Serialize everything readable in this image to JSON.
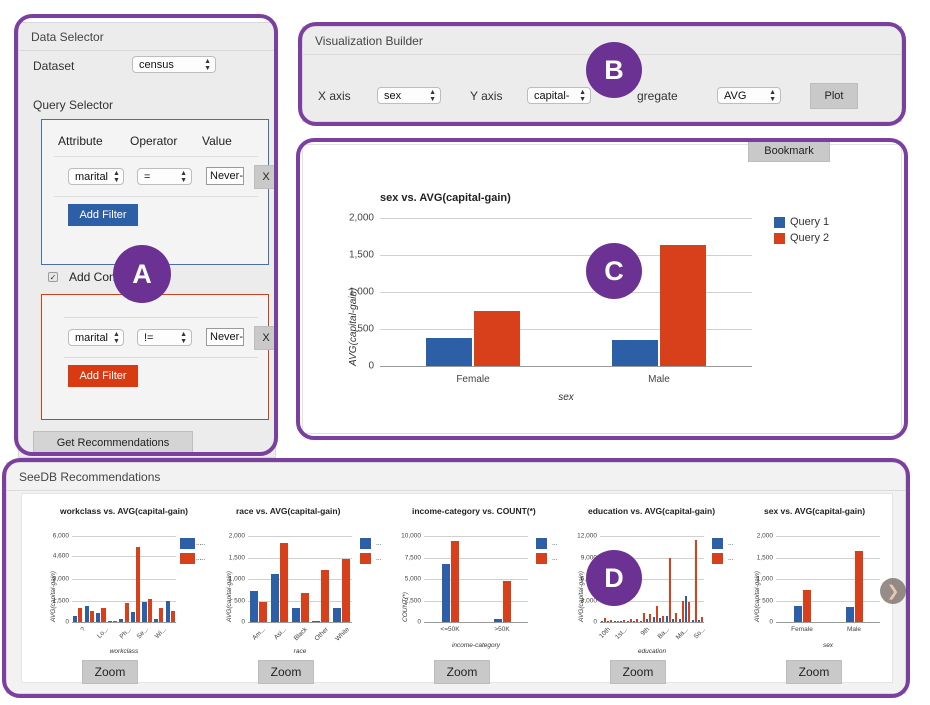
{
  "colors": {
    "annotation_purple": "#7B3FA0",
    "badge_purple": "#6B3294",
    "query1_blue": "#2D5FA6",
    "query2_red": "#D8401B",
    "panel_grey": "#ececec"
  },
  "data_selector": {
    "title": "Data Selector",
    "dataset_label": "Dataset",
    "dataset_value": "census",
    "query_selector_label": "Query Selector",
    "columns": {
      "attribute": "Attribute",
      "operator": "Operator",
      "value": "Value"
    },
    "query1": {
      "attribute": "marital",
      "operator": "=",
      "value": "Never-",
      "remove_label": "X",
      "add_filter_label": "Add Filter"
    },
    "add_comparison_label": "Add Compa",
    "add_comparison_checked": true,
    "query2": {
      "attribute": "marital",
      "operator": "!=",
      "value": "Never-",
      "remove_label": "X",
      "add_filter_label": "Add Filter"
    },
    "get_recommendations_label": "Get Recommendations"
  },
  "visualization_builder": {
    "title": "Visualization Builder",
    "x_axis_label": "X axis",
    "x_axis_value": "sex",
    "y_axis_label": "Y axis",
    "y_axis_value": "capital-",
    "aggregate_label": "gregate",
    "aggregate_value": "AVG",
    "plot_label": "Plot"
  },
  "main_view": {
    "bookmark_label": "Bookmark"
  },
  "recommendations": {
    "title": "SeeDB Recommendations",
    "zoom_label": "Zoom",
    "next_arrow": "chevron-right-icon"
  },
  "badges": [
    {
      "letter": "A"
    },
    {
      "letter": "B"
    },
    {
      "letter": "C"
    },
    {
      "letter": "D"
    }
  ],
  "chart_data": [
    {
      "id": "main",
      "type": "bar",
      "title": "sex vs. AVG(capital-gain)",
      "xlabel": "sex",
      "ylabel": "AVG(capital-gain)",
      "categories": [
        "Female",
        "Male"
      ],
      "ylim": [
        0,
        2000
      ],
      "yticks": [
        0,
        500,
        1000,
        1500,
        2000
      ],
      "ytick_labels": [
        "0",
        "500",
        "1,000",
        "1,500",
        "2,000"
      ],
      "legend": [
        "Query 1",
        "Query 2"
      ],
      "legend_position": "right",
      "grid": true,
      "series": [
        {
          "name": "Query 1",
          "values": [
            375,
            355
          ]
        },
        {
          "name": "Query 2",
          "values": [
            750,
            1640
          ]
        }
      ]
    },
    {
      "id": "rec-workclass",
      "type": "bar",
      "title": "workclass vs. AVG(capital-gain)",
      "xlabel": "workclass",
      "ylabel": "AVG(capital-gain)",
      "categories": [
        "?",
        "Lo...",
        "Ph...",
        "Se...",
        "Wi..."
      ],
      "tick_positions": [
        0,
        2,
        4,
        5.5,
        7
      ],
      "ylim": [
        0,
        6000
      ],
      "yticks": [
        0,
        1500,
        3000,
        4600,
        6000
      ],
      "ytick_labels": [
        "0",
        "1,500",
        "3,000",
        "4,600",
        "6,000"
      ],
      "legend": [
        "...",
        "..."
      ],
      "grid": true,
      "series": [
        {
          "name": "Query 1",
          "values": [
            400,
            1150,
            620,
            20,
            220,
            700,
            1380,
            200,
            1450
          ]
        },
        {
          "name": "Query 2",
          "values": [
            1000,
            740,
            950,
            25,
            1300,
            5250,
            1620,
            1000,
            800
          ]
        }
      ]
    },
    {
      "id": "rec-race",
      "type": "bar",
      "title": "race vs. AVG(capital-gain)",
      "xlabel": "race",
      "ylabel": "AVG(capital-gain)",
      "categories": [
        "Am...",
        "Asi...",
        "Black",
        "Other",
        "White"
      ],
      "ylim": [
        0,
        2000
      ],
      "yticks": [
        0,
        500,
        1000,
        1500,
        2000
      ],
      "ytick_labels": [
        "0",
        "500",
        "1,000",
        "1,500",
        "2,000"
      ],
      "legend": [
        "...",
        "..."
      ],
      "grid": true,
      "series": [
        {
          "name": "Query 1",
          "values": [
            730,
            1120,
            320,
            15,
            320
          ]
        },
        {
          "name": "Query 2",
          "values": [
            470,
            1830,
            680,
            1210,
            1470
          ]
        }
      ]
    },
    {
      "id": "rec-income",
      "type": "bar",
      "title": "income-category vs. COUNT(*)",
      "xlabel": "income-category",
      "ylabel": "COUNT(*)",
      "categories": [
        "<=50K",
        ">50K"
      ],
      "ylim": [
        0,
        10000
      ],
      "yticks": [
        0,
        2500,
        5000,
        7500,
        10000
      ],
      "ytick_labels": [
        "0",
        "2,500",
        "5,000",
        "7,500",
        "10,000"
      ],
      "legend": [
        "...",
        "..."
      ],
      "grid": true,
      "series": [
        {
          "name": "Query 1",
          "values": [
            6700,
            300
          ]
        },
        {
          "name": "Query 2",
          "values": [
            9400,
            4800
          ]
        }
      ]
    },
    {
      "id": "rec-education",
      "type": "bar",
      "title": "education vs. AVG(capital-gain)",
      "xlabel": "education",
      "ylabel": "AVG(capital-gain)",
      "categories": [
        "10th",
        "1st...",
        "9th",
        "Ba...",
        "Ma...",
        "So..."
      ],
      "tick_positions": [
        0,
        2.5,
        6,
        9,
        12,
        14.5
      ],
      "ylim": [
        0,
        12000
      ],
      "yticks": [
        0,
        3000,
        6000,
        9000,
        12000
      ],
      "ytick_labels": [
        "0",
        "3,000",
        "6,000",
        "9,000",
        "12,000"
      ],
      "legend": [
        "...",
        "..."
      ],
      "grid": true,
      "series": [
        {
          "name": "Query 1",
          "values": [
            180,
            120,
            90,
            60,
            200,
            120,
            150,
            400,
            700,
            600,
            800,
            350,
            400,
            3600,
            300,
            250
          ]
        },
        {
          "name": "Query 2",
          "values": [
            500,
            300,
            200,
            250,
            400,
            350,
            1200,
            1100,
            2200,
            900,
            8900,
            1200,
            2900,
            2850,
            11400,
            700
          ]
        }
      ]
    },
    {
      "id": "rec-sex",
      "type": "bar",
      "title": "sex vs. AVG(capital-gain)",
      "xlabel": "sex",
      "ylabel": "AVG(capital-gain)",
      "categories": [
        "Female",
        "Male"
      ],
      "ylim": [
        0,
        2000
      ],
      "yticks": [
        0,
        500,
        1000,
        1500,
        2000
      ],
      "ytick_labels": [
        "0",
        "500",
        "1,000",
        "1,500",
        "2,000"
      ],
      "legend": [
        "...",
        "..."
      ],
      "grid": true,
      "series": [
        {
          "name": "Query 1",
          "values": [
            375,
            355
          ]
        },
        {
          "name": "Query 2",
          "values": [
            750,
            1640
          ]
        }
      ]
    }
  ]
}
